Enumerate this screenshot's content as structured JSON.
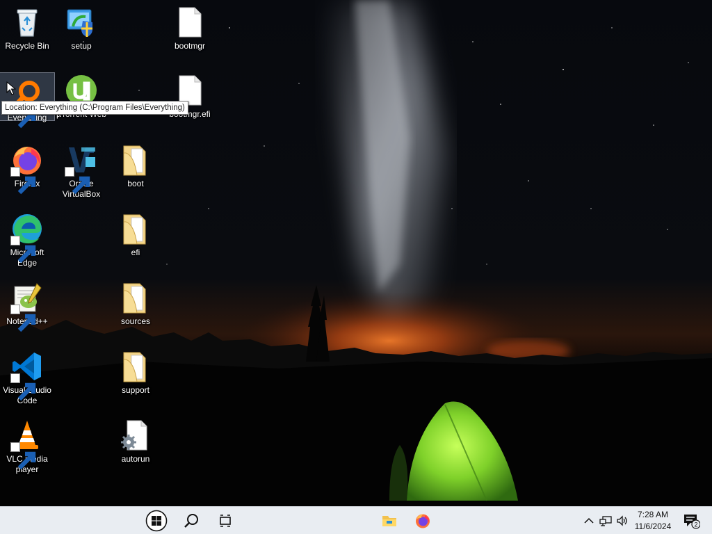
{
  "desktop": {
    "icons": [
      {
        "label": "Recycle Bin",
        "icon": "recycle-bin-icon"
      },
      {
        "label": "setup",
        "icon": "setup-icon"
      },
      {
        "label": "bootmgr",
        "icon": "file-icon"
      },
      {
        "label": "Everything",
        "icon": "everything-icon",
        "selected": true
      },
      {
        "label": "µTorrent Web",
        "icon": "utorrent-icon"
      },
      {
        "label": "bootmgr.efi",
        "icon": "file-icon"
      },
      {
        "label": "Firefox",
        "icon": "firefox-icon"
      },
      {
        "label": "Oracle VirtualBox",
        "icon": "virtualbox-icon"
      },
      {
        "label": "boot",
        "icon": "folder-icon"
      },
      {
        "label": "Microsoft Edge",
        "icon": "edge-icon"
      },
      {
        "label": "efi",
        "icon": "folder-icon"
      },
      {
        "label": "Notepad++",
        "icon": "notepadpp-icon"
      },
      {
        "label": "sources",
        "icon": "folder-icon"
      },
      {
        "label": "Visual Studio Code",
        "icon": "vscode-icon"
      },
      {
        "label": "support",
        "icon": "folder-icon"
      },
      {
        "label": "VLC media player",
        "icon": "vlc-icon"
      },
      {
        "label": "autorun",
        "icon": "autorun-settings-icon"
      }
    ],
    "tooltip": "Location: Everything (C:\\Program Files\\Everything)"
  },
  "taskbar": {
    "start": "windows-start-icon",
    "search": "search-icon",
    "task_view": "task-view-icon",
    "pinned": [
      "file-explorer-icon",
      "firefox-icon"
    ],
    "tray": [
      "chevron-up-icon",
      "network-icon",
      "volume-icon"
    ],
    "time": "7:28 AM",
    "date": "11/6/2024",
    "notification_count": "2"
  },
  "colors": {
    "taskbar_bg": "#e9edf2",
    "sky_dark": "#05070b",
    "horizon_glow": "#d0561c",
    "tent_green": "#7fd12a"
  }
}
